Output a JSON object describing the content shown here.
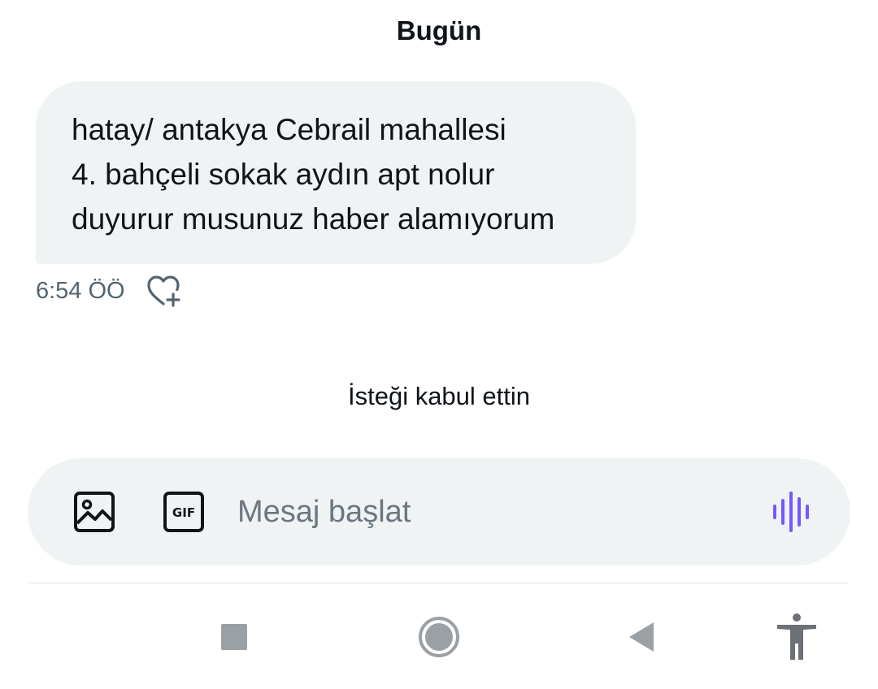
{
  "conversation": {
    "date_header": "Bugün",
    "message": {
      "lines": [
        "hatay/ antakya Cebrail mahallesi",
        "4. bahçeli sokak aydın apt nolur",
        "duyurur musunuz haber alamıyorum"
      ],
      "timestamp": "6:54 ÖÖ"
    },
    "system_note": "İsteği kabul ettin"
  },
  "composer": {
    "placeholder": "Mesaj başlat",
    "value": "",
    "gif_label": "GIF"
  },
  "icons": {
    "react": "heart-plus-icon",
    "media": "image-icon",
    "gif": "gif-icon",
    "voice": "voice-wave-icon",
    "nav_recents": "square-icon",
    "nav_home": "circle-icon",
    "nav_back": "triangle-back-icon",
    "nav_accessibility": "accessibility-icon"
  },
  "colors": {
    "bubble_bg": "#eff3f4",
    "text_primary": "#0f1419",
    "text_secondary": "#536471",
    "voice_accent": "#7856ff",
    "nav_gray": "#9aa0a4"
  }
}
